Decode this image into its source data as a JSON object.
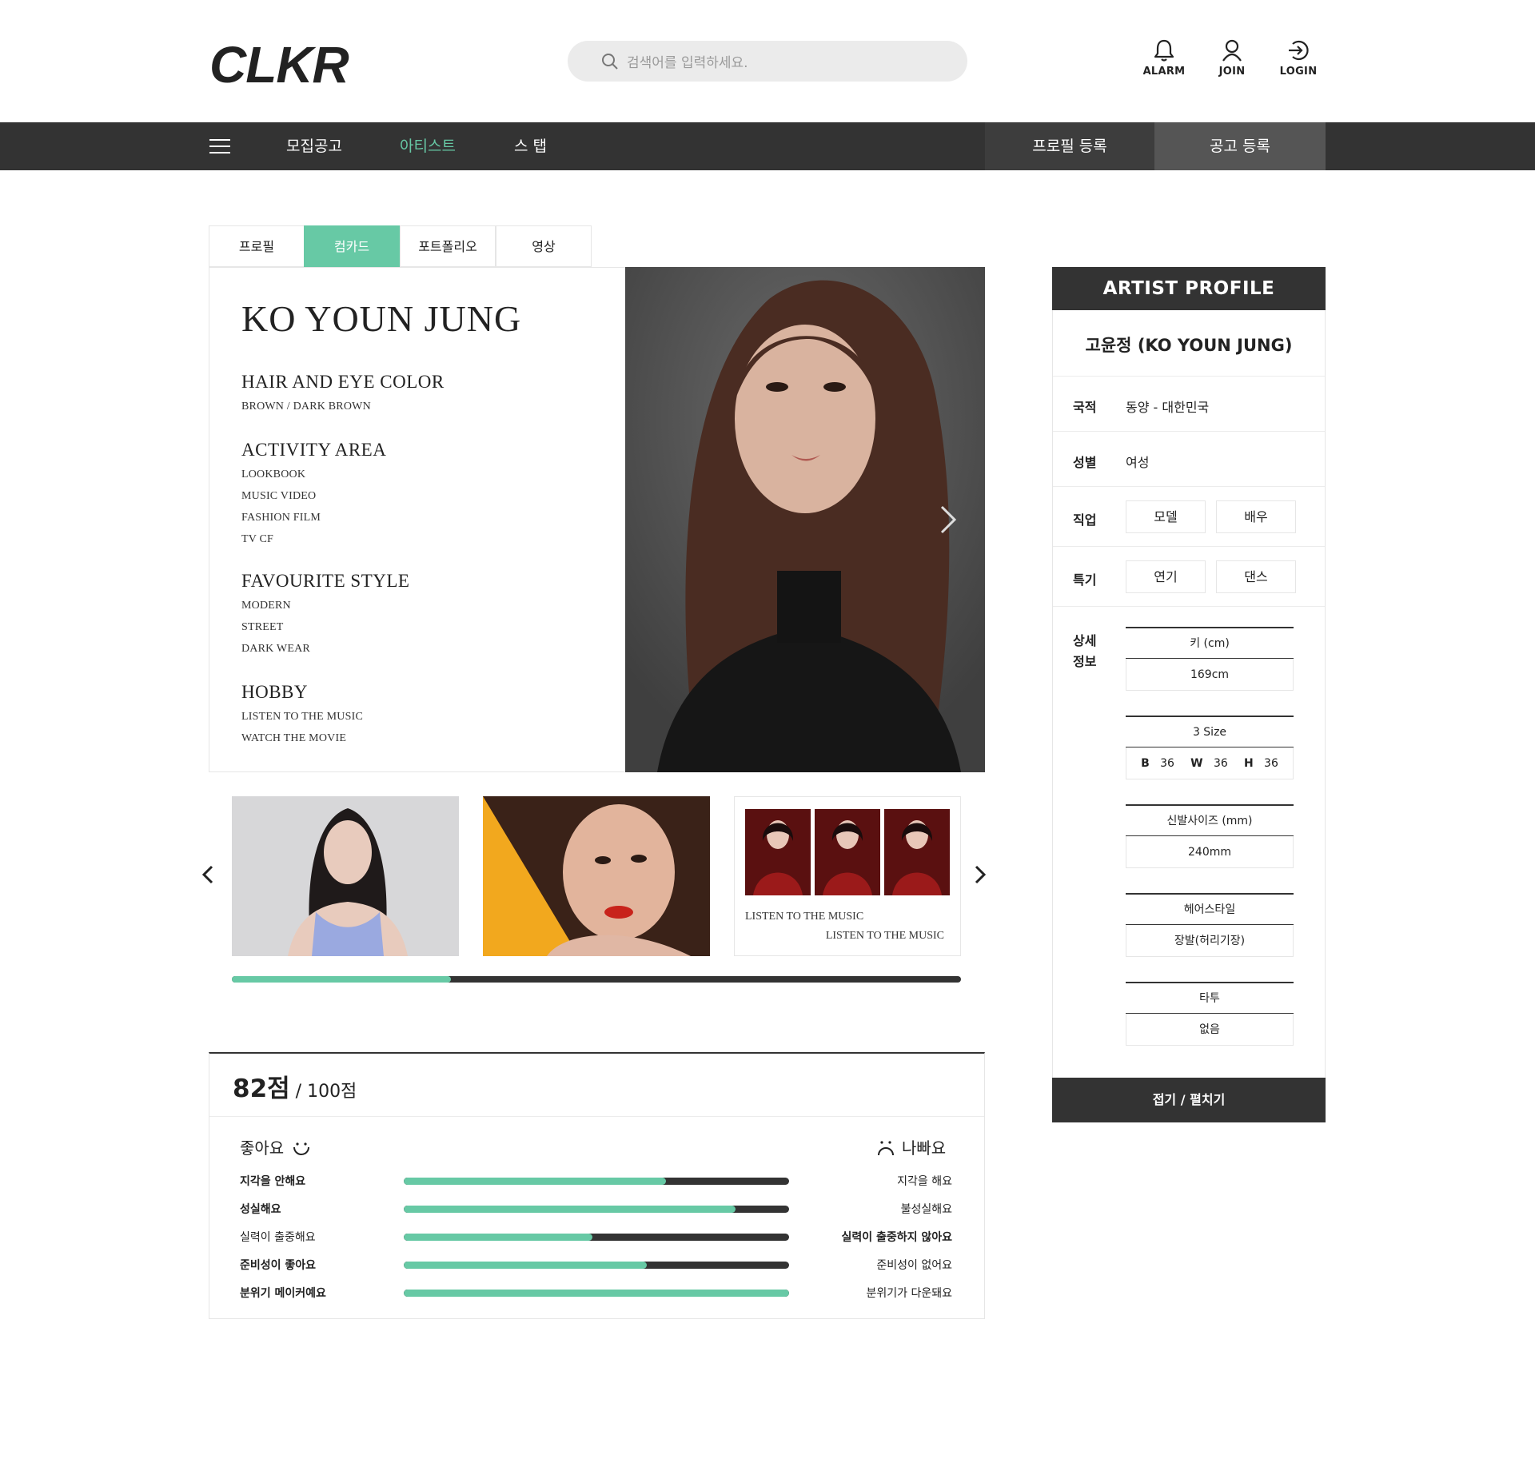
{
  "header": {
    "logo": "CLKR",
    "search_placeholder": "검색어를 입력하세요.",
    "icons": [
      {
        "name": "bell-icon",
        "label": "ALARM"
      },
      {
        "name": "user-icon",
        "label": "JOIN"
      },
      {
        "name": "login-icon",
        "label": "LOGIN"
      }
    ]
  },
  "nav": {
    "items": [
      "모집공고",
      "아티스트",
      "스 탭"
    ],
    "active_index": 1,
    "buttons": [
      "프로필 등록",
      "공고 등록"
    ]
  },
  "tabs": [
    "프로필",
    "컴카드",
    "포트폴리오",
    "영상"
  ],
  "active_tab": 1,
  "compcard": {
    "name": "KO YOUN JUNG",
    "sections": [
      {
        "title": "HAIR AND EYE COLOR",
        "items": [
          "BROWN / DARK BROWN"
        ]
      },
      {
        "title": "ACTIVITY AREA",
        "items": [
          "LOOKBOOK",
          "MUSIC VIDEO",
          "FASHION FILM",
          "TV CF"
        ]
      },
      {
        "title": "FAVOURITE STYLE",
        "items": [
          "MODERN",
          "STREET",
          "DARK WEAR"
        ]
      },
      {
        "title": "HOBBY",
        "items": [
          "LISTEN TO THE MUSIC",
          "WATCH THE MOVIE"
        ]
      }
    ]
  },
  "thumbnails": {
    "caption_1": "LISTEN TO THE MUSIC",
    "caption_2": "LISTEN TO THE MUSIC",
    "progress": 0.3
  },
  "score": {
    "value": "82점",
    "total": " / 100점",
    "good_label": "좋아요",
    "bad_label": "나빠요",
    "rows": [
      {
        "left": "지각을 안해요",
        "right": "지각을 해요",
        "value": 0.68,
        "left_bold": true,
        "right_bold": false
      },
      {
        "left": "성실해요",
        "right": "불성실해요",
        "value": 0.86,
        "left_bold": true,
        "right_bold": false
      },
      {
        "left": "실력이 출중해요",
        "right": "실력이 출중하지 않아요",
        "value": 0.49,
        "left_bold": false,
        "right_bold": true
      },
      {
        "left": "준비성이 좋아요",
        "right": "준비성이 없어요",
        "value": 0.63,
        "left_bold": true,
        "right_bold": false
      },
      {
        "left": "분위기 메이커예요",
        "right": "분위기가 다운돼요",
        "value": 1.0,
        "left_bold": true,
        "right_bold": false
      }
    ]
  },
  "artist_profile": {
    "heading": "ARTIST PROFILE",
    "name": "고윤정 (KO YOUN JUNG)",
    "nationality_label": "국적",
    "nationality": "동양 - 대한민국",
    "gender_label": "성별",
    "gender": "여성",
    "job_label": "직업",
    "jobs": [
      "모델",
      "배우"
    ],
    "skill_label": "특기",
    "skills": [
      "연기",
      "댄스"
    ],
    "detail_label_1": "상세",
    "detail_label_2": "정보",
    "height_label": "키 (cm)",
    "height": "169cm",
    "size_label": "3 Size",
    "sizes": {
      "b_label": "B",
      "b": "36",
      "w_label": "W",
      "w": "36",
      "h_label": "H",
      "h": "36"
    },
    "shoe_label": "신발사이즈 (mm)",
    "shoe": "240mm",
    "hair_label": "헤어스타일",
    "hair": "장발(허리기장)",
    "tattoo_label": "타투",
    "tattoo": "없음",
    "toggle": "접기 / 펼치기"
  },
  "colors": {
    "accent": "#67c9a5",
    "dark": "#333333",
    "nav_btn2": "#555555"
  }
}
